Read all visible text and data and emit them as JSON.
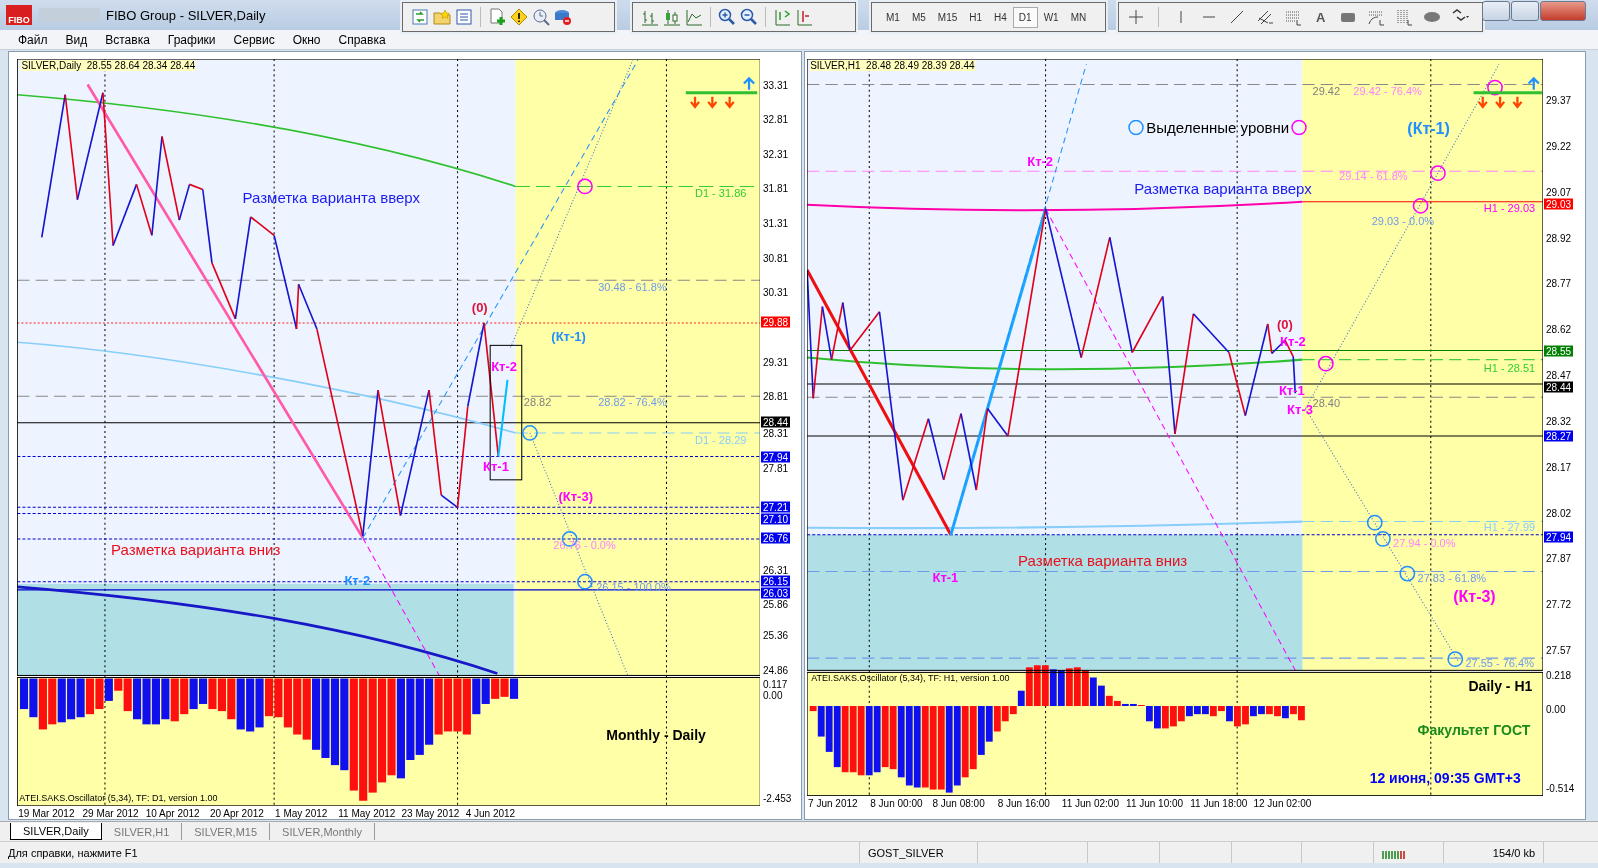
{
  "window": {
    "logo": "FIBO",
    "title": "FIBO Group - SILVER,Daily"
  },
  "toolbars": {
    "timeframes": [
      {
        "label": "M1",
        "selected": false
      },
      {
        "label": "M5",
        "selected": false
      },
      {
        "label": "M15",
        "selected": false
      },
      {
        "label": "H1",
        "selected": false
      },
      {
        "label": "H4",
        "selected": false
      },
      {
        "label": "D1",
        "selected": true
      },
      {
        "label": "W1",
        "selected": false
      },
      {
        "label": "MN",
        "selected": false
      }
    ],
    "text_tool": "A"
  },
  "menu": [
    "Файл",
    "Вид",
    "Вставка",
    "Графики",
    "Сервис",
    "Окно",
    "Справка"
  ],
  "charts": [
    {
      "header": {
        "symbol": "SILVER,Daily",
        "prices": "28.55 28.64 28.34 28.44"
      },
      "annotations": [
        {
          "text": "D1 - 31.86",
          "kind": "plain",
          "color": "#32cd32"
        },
        {
          "text": "Разметка варианта вверх",
          "kind": "heading",
          "color": "#1c1cf0"
        },
        {
          "text": "30.48 - 61.8%",
          "kind": "plain",
          "color": "#6f9be8"
        },
        {
          "text": "(0)",
          "kind": "bold",
          "color": "#dc143c"
        },
        {
          "text": "(Кт-1)",
          "kind": "bold",
          "color": "#1e90ff"
        },
        {
          "text": "Кт-2",
          "kind": "bold",
          "color": "#ff00ff"
        },
        {
          "text": "28.82",
          "kind": "plain",
          "color": "#808080"
        },
        {
          "text": "28.82 - 76.4%",
          "kind": "plain",
          "color": "#6f9be8"
        },
        {
          "text": "D1 - 28.29",
          "kind": "plain",
          "color": "#87cefa"
        },
        {
          "text": "Кт-1",
          "kind": "bold",
          "color": "#ff00ff"
        },
        {
          "text": "(Кт-3)",
          "kind": "bold",
          "color": "#ff00ff"
        },
        {
          "text": "26.76 - 0.0%",
          "kind": "plain",
          "color": "#ff80ff"
        },
        {
          "text": "Разметка варианта вниз",
          "kind": "heading",
          "color": "#e8101c"
        },
        {
          "text": "Кт-2",
          "kind": "bold",
          "color": "#1e90ff"
        },
        {
          "text": "26.15 - 100.0%",
          "kind": "plain",
          "color": "#6f9be8"
        },
        {
          "text": "Monthly - Daily",
          "kind": "note",
          "color": "#000000"
        }
      ],
      "price_ticks": [
        "33.31",
        "32.81",
        "32.31",
        "31.81",
        "31.31",
        "30.81",
        "30.31",
        "29.31",
        "28.81",
        "28.31",
        "27.81",
        "26.31",
        "25.86",
        "25.36",
        "24.86"
      ],
      "price_tags": [
        {
          "text": "29.88",
          "color": "#ff0000"
        },
        {
          "text": "28.44",
          "color": "#000000"
        },
        {
          "text": "27.94",
          "color": "#0000ee"
        },
        {
          "text": "27.21",
          "color": "#0000ee"
        },
        {
          "text": "27.10",
          "color": "#0000ee"
        },
        {
          "text": "26.76",
          "color": "#0000ee"
        },
        {
          "text": "26.15",
          "color": "#0000ee"
        },
        {
          "text": "26.03",
          "color": "#0000ee"
        }
      ],
      "oscillator": {
        "title": "ATEI.SAKS.Oscillator (5,34), TF: D1, version 1.00",
        "ticks": [
          "0.117",
          "0.00",
          "-2.453"
        ]
      },
      "time_axis": [
        "19 Mar 2012",
        "29 Mar 2012",
        "10 Apr 2012",
        "20 Apr 2012",
        "1 May 2012",
        "11 May 2012",
        "23 May 2012",
        "4 Jun 2012"
      ]
    },
    {
      "header": {
        "symbol": "SILVER,H1",
        "prices": "28.48 28.49 28.39 28.44"
      },
      "legend": {
        "text": "Выделенные уровни"
      },
      "annotations": [
        {
          "text": "29.42",
          "kind": "plain",
          "color": "#808080"
        },
        {
          "text": "29.42 - 76.4%",
          "kind": "plain",
          "color": "#ff80ff"
        },
        {
          "text": "(Кт-1)",
          "kind": "big",
          "color": "#1e90ff"
        },
        {
          "text": "Кт-2",
          "kind": "bold",
          "color": "#ff00ff"
        },
        {
          "text": "29.14 - 61.8%",
          "kind": "plain",
          "color": "#ff80ff"
        },
        {
          "text": "Разметка варианта вверх",
          "kind": "heading",
          "color": "#1c1cf0"
        },
        {
          "text": "H1 - 29.03",
          "kind": "plain",
          "color": "#ff00ff"
        },
        {
          "text": "29.03 - 0.0%",
          "kind": "plain",
          "color": "#6f9be8"
        },
        {
          "text": "(0)",
          "kind": "bold",
          "color": "#dc143c"
        },
        {
          "text": "Кт-2",
          "kind": "bold",
          "color": "#ff00ff"
        },
        {
          "text": "H1 - 28.51",
          "kind": "plain",
          "color": "#32cd32"
        },
        {
          "text": "Кт-1",
          "kind": "bold",
          "color": "#ff00ff"
        },
        {
          "text": "28.40",
          "kind": "plain",
          "color": "#808080"
        },
        {
          "text": "Кт-3",
          "kind": "bold",
          "color": "#ff00ff"
        },
        {
          "text": "H1 - 27.99",
          "kind": "plain",
          "color": "#87cefa"
        },
        {
          "text": "27.94 - 0.0%",
          "kind": "plain",
          "color": "#ff80ff"
        },
        {
          "text": "Разметка варианта вниз",
          "kind": "heading",
          "color": "#e8101c"
        },
        {
          "text": "Кт-1",
          "kind": "bold",
          "color": "#ff00ff"
        },
        {
          "text": "27.83 - 61.8%",
          "kind": "plain",
          "color": "#6f9be8"
        },
        {
          "text": "(Кт-3)",
          "kind": "big",
          "color": "#ff00ff"
        },
        {
          "text": "27.55 - 76.4%",
          "kind": "plain",
          "color": "#6f9be8"
        },
        {
          "text": "Daily - H1",
          "kind": "note",
          "color": "#000000"
        },
        {
          "text": "Факультет ГОСТ",
          "kind": "note",
          "color": "#1a8a1a"
        },
        {
          "text": "12 июня, 09:35  GMT+3",
          "kind": "note",
          "color": "#0000ff"
        }
      ],
      "price_ticks": [
        "29.37",
        "29.22",
        "29.07",
        "28.92",
        "28.77",
        "28.62",
        "28.47",
        "28.32",
        "28.17",
        "28.02",
        "27.87",
        "27.72",
        "27.57"
      ],
      "price_tags": [
        {
          "text": "29.03",
          "color": "#ff0000"
        },
        {
          "text": "28.55",
          "color": "#008000"
        },
        {
          "text": "28.44",
          "color": "#000000"
        },
        {
          "text": "28.27",
          "color": "#0000ee"
        },
        {
          "text": "27.94",
          "color": "#0000ee"
        }
      ],
      "oscillator": {
        "title": "ATEI.SAKS.Oscillator (5,34), TF: H1, version 1.00",
        "ticks": [
          "0.218",
          "0.00",
          "-0.514"
        ]
      },
      "time_axis": [
        "7 Jun 2012",
        "8 Jun 00:00",
        "8 Jun 08:00",
        "8 Jun 16:00",
        "11 Jun 02:00",
        "11 Jun 10:00",
        "11 Jun 18:00",
        "12 Jun 02:00"
      ]
    }
  ],
  "tabs": [
    {
      "label": "SILVER,Daily",
      "selected": true
    },
    {
      "label": "SILVER,H1",
      "selected": false
    },
    {
      "label": "SILVER,M15",
      "selected": false
    },
    {
      "label": "SILVER,Monthly",
      "selected": false
    }
  ],
  "status_bar": {
    "help": "Для справки, нажмите F1",
    "profile": "GOST_SILVER",
    "traffic": "154/0 kb"
  }
}
